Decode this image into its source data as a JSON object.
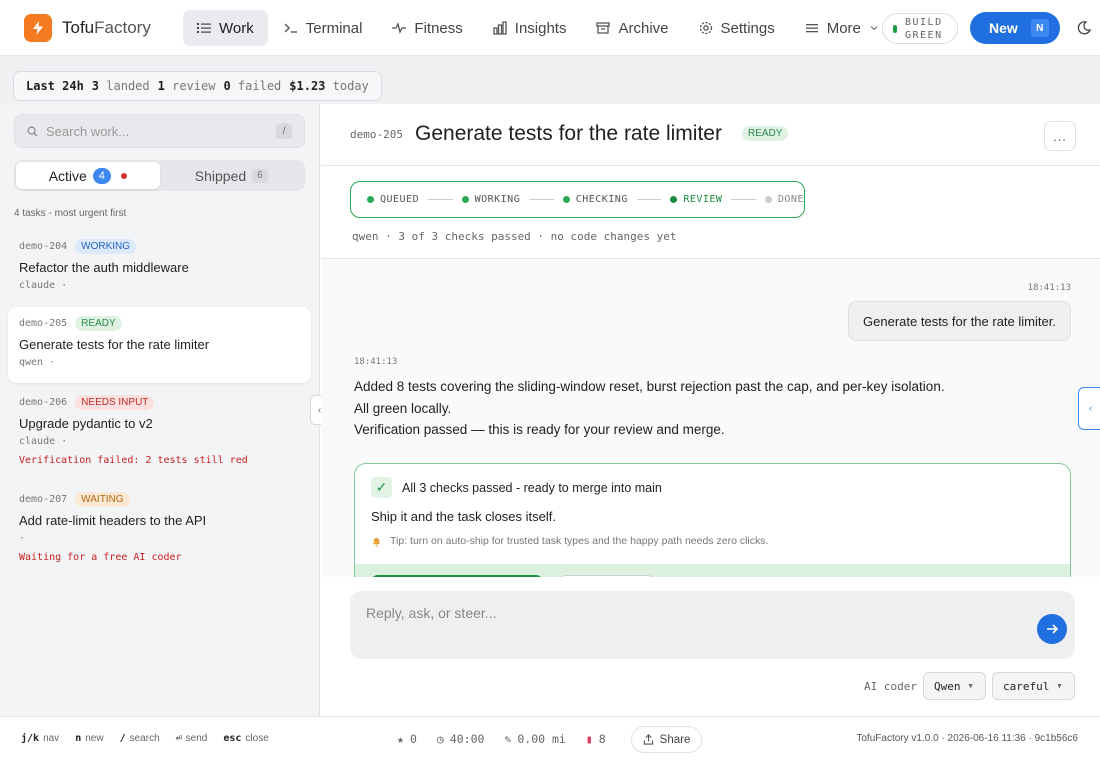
{
  "app": {
    "brand_a": "Tofu",
    "brand_b": "Factory"
  },
  "nav": [
    {
      "label": "Work",
      "icon": "list-icon",
      "active": true
    },
    {
      "label": "Terminal",
      "icon": "terminal-icon"
    },
    {
      "label": "Fitness",
      "icon": "pulse-icon"
    },
    {
      "label": "Insights",
      "icon": "bar-chart-icon"
    },
    {
      "label": "Archive",
      "icon": "archive-icon"
    },
    {
      "label": "Settings",
      "icon": "gear-icon"
    },
    {
      "label": "More",
      "icon": "menu-icon"
    }
  ],
  "build": {
    "line1": "BUILD",
    "line2": "GREEN",
    "color": "#1a9e4a"
  },
  "new_button": {
    "label": "New",
    "kbd": "N",
    "color": "#1f6fe0"
  },
  "stats": {
    "range": "Last 24h",
    "landed_n": "3",
    "landed_label": "landed",
    "review_n": "1",
    "review_label": "review",
    "failed_n": "0",
    "failed_label": "failed",
    "cost": "$1.23",
    "cost_label": "today"
  },
  "sidebar": {
    "search_placeholder": "Search work...",
    "search_kbd": "/",
    "tabs": {
      "active_label": "Active",
      "active_count": "4",
      "shipped_label": "Shipped",
      "shipped_count": "6"
    },
    "caption": "4 tasks - most urgent first",
    "tasks": [
      {
        "id": "demo-204",
        "status": "WORKING",
        "title": "Refactor the auth middleware",
        "coder": "claude ·",
        "error": ""
      },
      {
        "id": "demo-205",
        "status": "READY",
        "title": "Generate tests for the rate limiter",
        "coder": "qwen ·",
        "error": ""
      },
      {
        "id": "demo-206",
        "status": "NEEDS INPUT",
        "title": "Upgrade pydantic to v2",
        "coder": "claude ·",
        "error": "Verification failed: 2 tests still red"
      },
      {
        "id": "demo-207",
        "status": "WAITING",
        "title": "Add rate-limit headers to the API",
        "coder": "·",
        "error": "Waiting for a free AI coder"
      }
    ]
  },
  "main": {
    "id": "demo-205",
    "title": "Generate tests for the rate limiter",
    "status": "READY",
    "more": "...",
    "pipeline": [
      "QUEUED",
      "WORKING",
      "CHECKING",
      "REVIEW",
      "DONE"
    ],
    "meta": "qwen · 3 of 3 checks passed · no code changes yet"
  },
  "chat": {
    "user_time": "18:41:13",
    "user_msg": "Generate tests for the rate limiter.",
    "ai_time": "18:41:13",
    "ai_lines": [
      "Added 8 tests covering the sliding-window reset, burst rejection past the cap, and per-key isolation.",
      "All green locally.",
      "Verification passed — this is ready for your review and merge."
    ],
    "card_check": "✓",
    "card_title": "All 3 checks passed - ready to merge into main",
    "card_sub": "Ship it and the task closes itself.",
    "card_tip": "Tip: turn on auto-ship for trusted task types and the happy path needs zero clicks."
  },
  "composer": {
    "placeholder": "Reply, ask, or steer...",
    "coder_label": "AI coder",
    "coder_value": "Qwen",
    "mode_value": "careful"
  },
  "footer": {
    "shortcuts": [
      {
        "key": "j/k",
        "label": "nav"
      },
      {
        "key": "n",
        "label": "new"
      },
      {
        "key": "/",
        "label": "search"
      },
      {
        "key": "⏎",
        "label": "send"
      },
      {
        "key": "esc",
        "label": "close"
      }
    ],
    "stars": "0",
    "timer": "40:00",
    "distance": "0.00 mi",
    "tokens": "8",
    "share": "Share",
    "version": "TofuFactory v1.0.0 · 2026-06-16 11:36 · 9c1b56c6"
  }
}
